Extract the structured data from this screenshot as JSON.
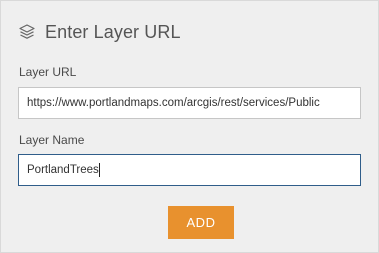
{
  "header": {
    "icon": "layers-icon",
    "title": "Enter Layer URL"
  },
  "form": {
    "url_label": "Layer URL",
    "url_value": "https://www.portlandmaps.com/arcgis/rest/services/Public",
    "name_label": "Layer Name",
    "name_value": "PortlandTrees"
  },
  "actions": {
    "add_label": "ADD",
    "add_color": "#e8912e"
  },
  "colors": {
    "panel_bg": "#efefef",
    "active_border": "#2f5d8a"
  }
}
